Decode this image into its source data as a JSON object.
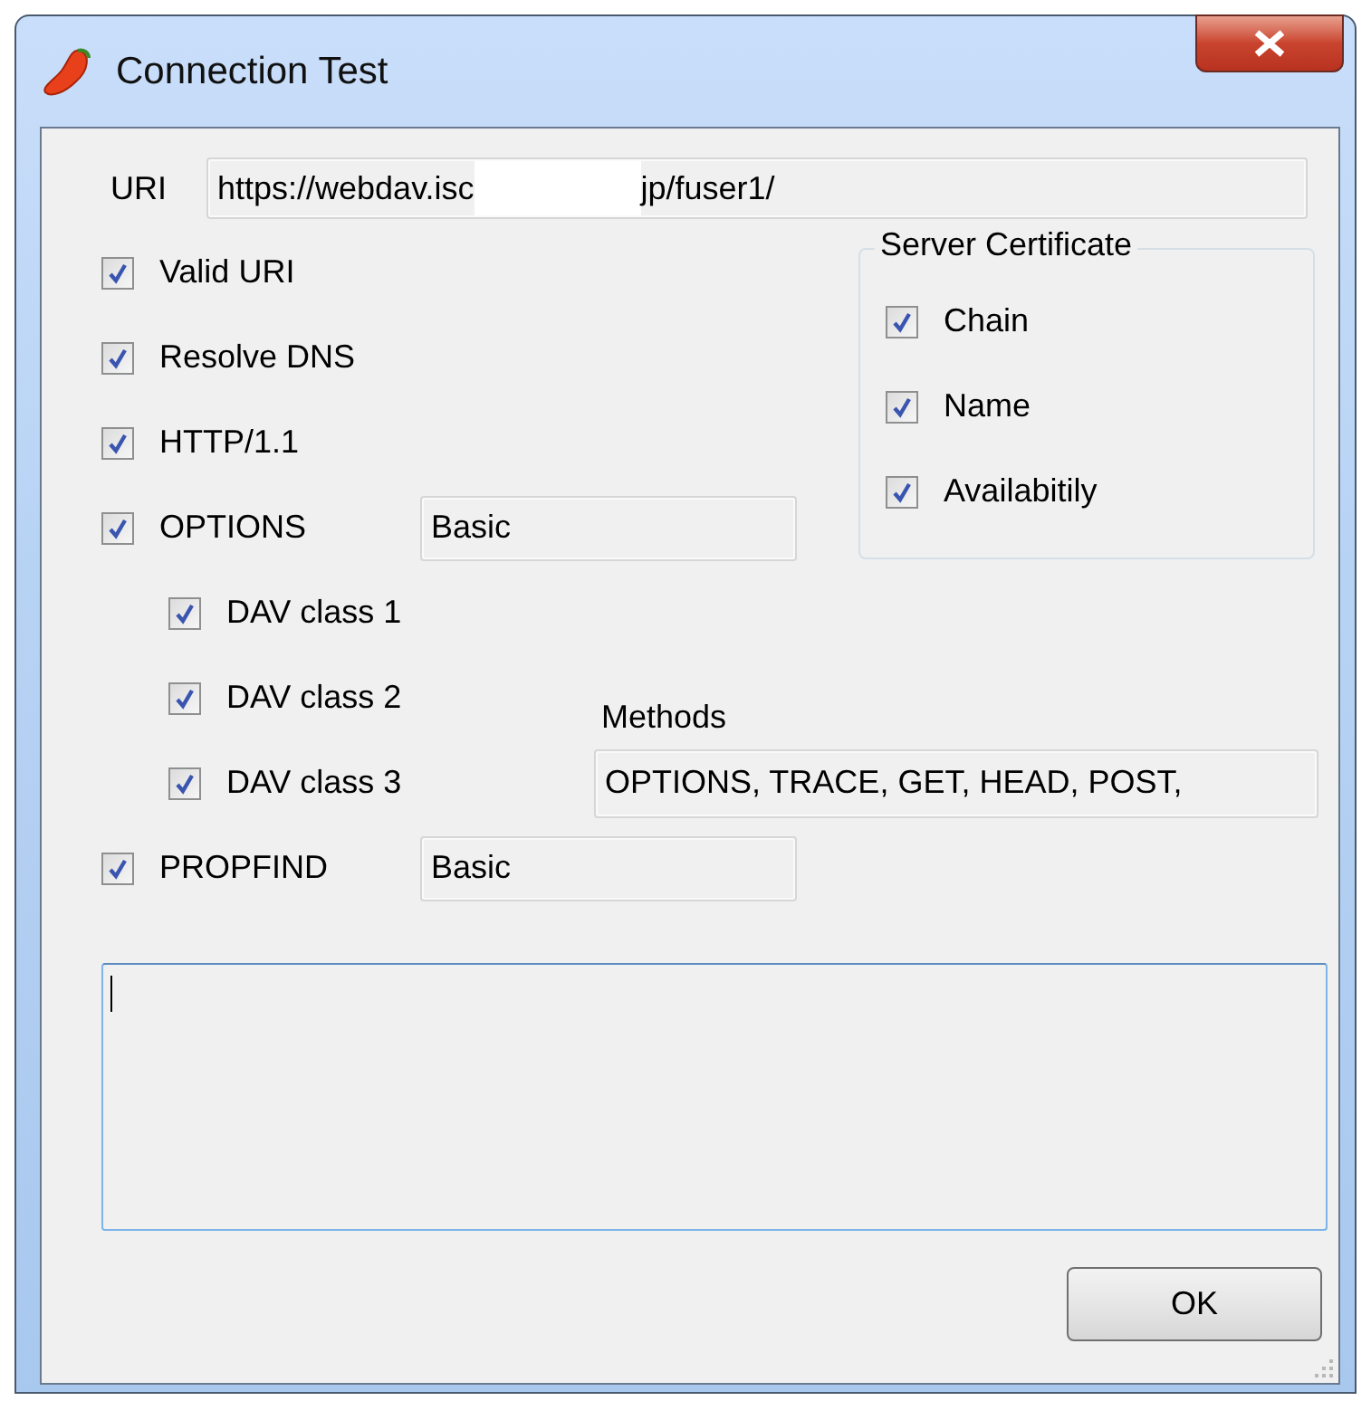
{
  "window": {
    "title": "Connection Test"
  },
  "uri": {
    "label": "URI",
    "value_start": "https://webdav.isc",
    "value_end": "jp/fuser1/"
  },
  "checks": [
    {
      "label": "Valid URI",
      "checked": true
    },
    {
      "label": "Resolve DNS",
      "checked": true
    },
    {
      "label": "HTTP/1.1",
      "checked": true
    },
    {
      "label": "OPTIONS",
      "checked": true,
      "auth": "Basic",
      "children": [
        {
          "label": "DAV class 1",
          "checked": true
        },
        {
          "label": "DAV class 2",
          "checked": true
        },
        {
          "label": "DAV class 3",
          "checked": true
        }
      ]
    },
    {
      "label": "PROPFIND",
      "checked": true,
      "auth": "Basic"
    }
  ],
  "server_certificate": {
    "title": "Server Certificate",
    "checks": [
      {
        "label": "Chain",
        "checked": true
      },
      {
        "label": "Name",
        "checked": true
      },
      {
        "label": "Availabitily",
        "checked": true
      }
    ]
  },
  "methods": {
    "label": "Methods",
    "value": "OPTIONS, TRACE, GET, HEAD, POST,"
  },
  "ok_button": "OK"
}
